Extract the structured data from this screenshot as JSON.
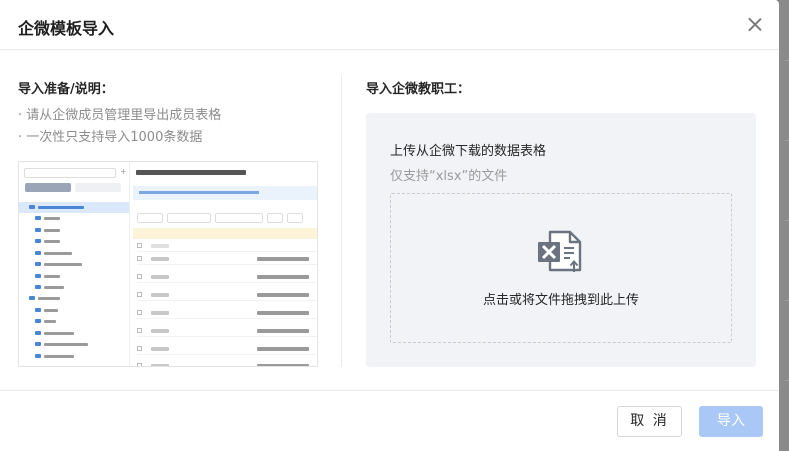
{
  "dialog": {
    "title": "企微模板导入"
  },
  "left": {
    "title": "导入准备/说明：",
    "notes": [
      "· 请从企微成员管理里导出成员表格",
      "· 一次性只支持导入1000条数据"
    ]
  },
  "right": {
    "title": "导入企微教职工：",
    "upload_title": "上传从企微下载的数据表格",
    "upload_sub": "仅支持“xlsx”的文件",
    "drop_text": "点击或将文件拖拽到此上传"
  },
  "footer": {
    "cancel_label": "取 消",
    "import_label": "导入"
  },
  "colors": {
    "primary_disabled": "#a9c8f5",
    "excel_icon": "#6b7380"
  },
  "icons": {
    "close": "close-icon",
    "file": "excel-file-upload-icon"
  }
}
